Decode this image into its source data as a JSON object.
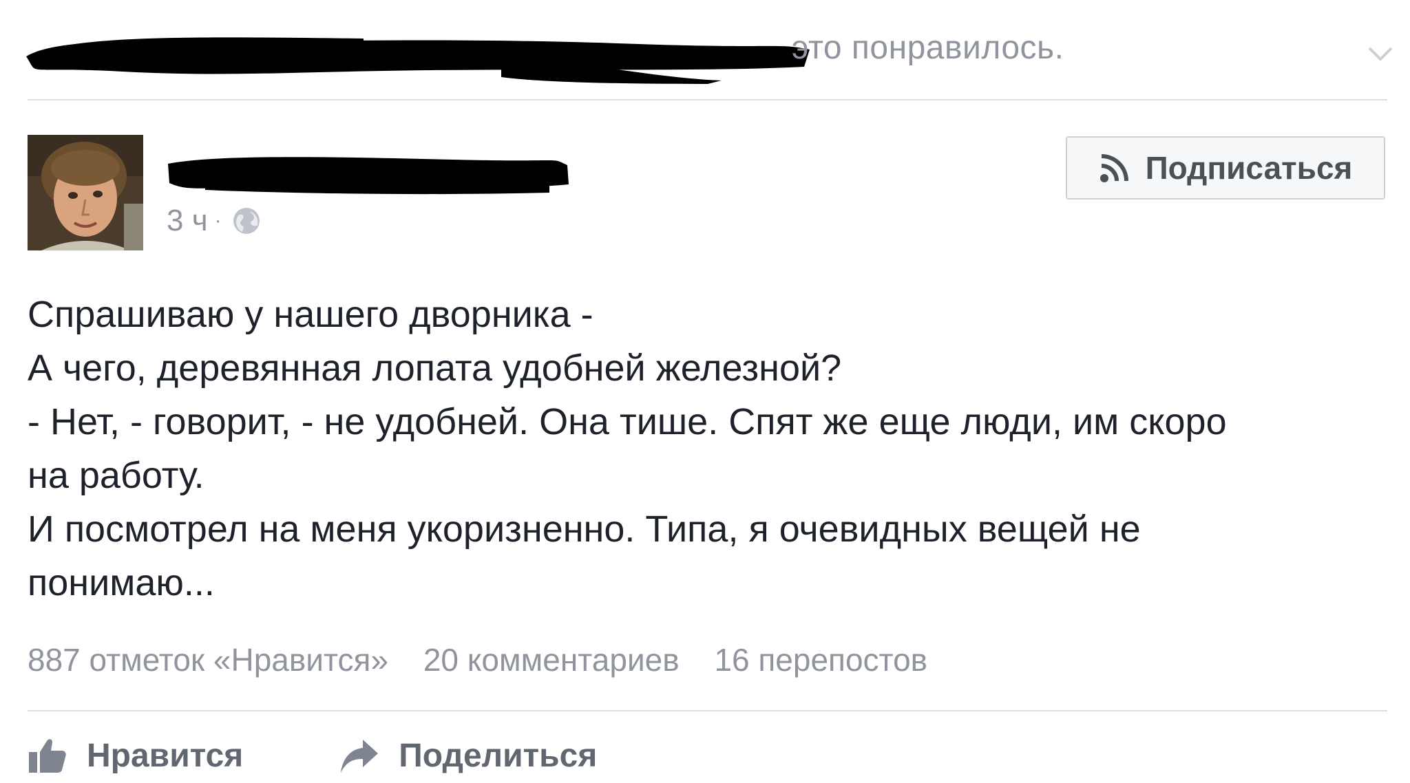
{
  "header": {
    "liked_text": "это понравилось."
  },
  "post": {
    "timestamp": "3 ч",
    "separator": "·",
    "follow_label": "Подписаться",
    "lines": [
      "Спрашиваю у нашего дворника -",
      "А чего, деревянная лопата удобней железной?",
      "- Нет, - говорит, - не удобней. Она тише. Спят же еще люди, им скоро",
      "на работу.",
      "И посмотрел на меня укоризненно. Типа, я очевидных вещей не",
      "понимаю..."
    ],
    "counts": {
      "likes": "887 отметок «Нравится»",
      "comments": "20 комментариев",
      "shares": "16 перепостов"
    }
  },
  "actions": {
    "like_label": "Нравится",
    "share_label": "Поделиться"
  },
  "colors": {
    "secondary_text": "#90949c",
    "primary_text": "#1d2129",
    "divider": "#dddfe2",
    "redaction": "#000000"
  },
  "icons": [
    "chevron-down-icon",
    "globe-icon",
    "rss-icon",
    "thumbs-up-icon",
    "share-arrow-icon"
  ]
}
